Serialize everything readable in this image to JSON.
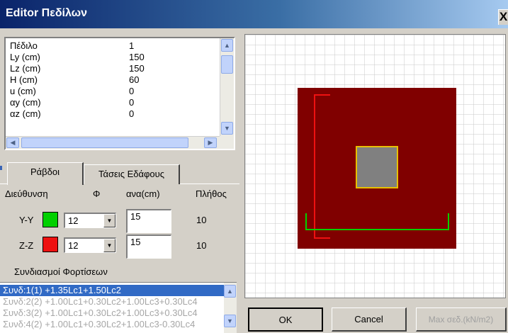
{
  "window": {
    "title": "Editor Πεδίλων",
    "close_glyph": "X"
  },
  "properties": [
    {
      "name": "Πέδιλο",
      "value": "1"
    },
    {
      "name": "Ly (cm)",
      "value": "150"
    },
    {
      "name": "Lz (cm)",
      "value": "150"
    },
    {
      "name": "H (cm)",
      "value": "60"
    },
    {
      "name": "u (cm)",
      "value": "0"
    },
    {
      "name": "αy (cm)",
      "value": "0"
    },
    {
      "name": "αz (cm)",
      "value": "0"
    }
  ],
  "tabs": {
    "rebars": "Ράβδοι",
    "soil_stresses": "Τάσεις Εδάφους"
  },
  "rebars": {
    "headers": {
      "direction": "Διεύθυνση",
      "diameter": "Φ",
      "spacing": "ανα(cm)",
      "count": "Πλήθος"
    },
    "rows": [
      {
        "direction": "Y-Y",
        "color": "#00d000",
        "diameter": "12",
        "spacing": "15",
        "count": "10"
      },
      {
        "direction": "Z-Z",
        "color": "#ee1111",
        "diameter": "12",
        "spacing": "15",
        "count": "10"
      }
    ]
  },
  "load_combinations": {
    "label": "Συνδιασμοί Φορτίσεων",
    "items": [
      "Συνδ:1(1) +1.35Lc1+1.50Lc2",
      "Συνδ:2(2) +1.00Lc1+0.30Lc2+1.00Lc3+0.30Lc4",
      "Συνδ:3(2) +1.00Lc1+0.30Lc2+1.00Lc3+0.30Lc4",
      "Συνδ:4(2) +1.00Lc1+0.30Lc2+1.00Lc3-0.30Lc4"
    ],
    "selected_index": 0
  },
  "buttons": {
    "ok": "OK",
    "cancel": "Cancel",
    "max_stress": "Max σεδ.(kN/m2)"
  },
  "colors": {
    "footing": "#800000",
    "column": "#808080",
    "column_outline": "#e8c000",
    "rebar_yy": "#00d000",
    "rebar_zz": "#ee1111"
  }
}
